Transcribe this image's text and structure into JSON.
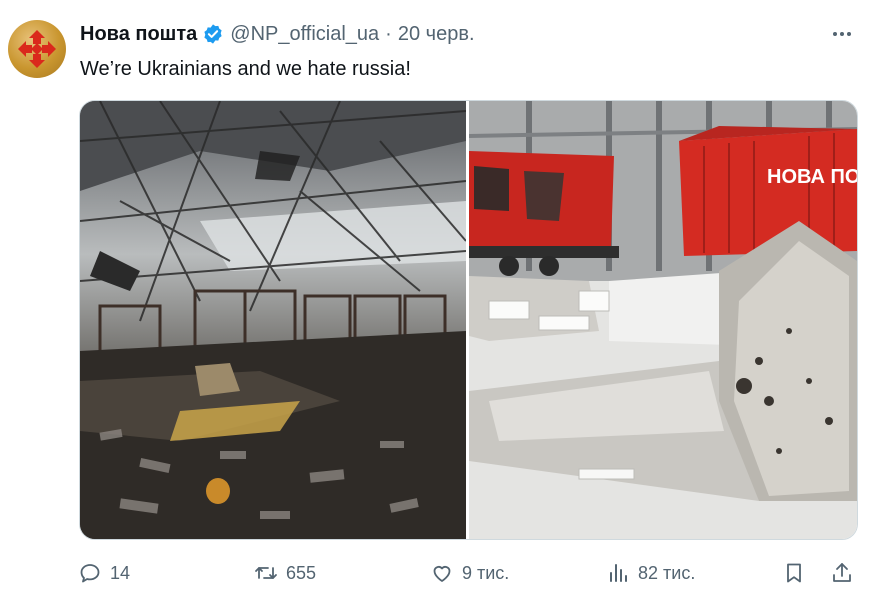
{
  "account": {
    "name": "Нова пошта",
    "handle": "@NP_official_ua",
    "separator": "·",
    "date": "20 черв."
  },
  "post": {
    "text": "We’re Ukrainians and we hate russia!"
  },
  "images": [
    {
      "label": "Destroyed warehouse interior"
    },
    {
      "label": "Damaged red trailers and debris",
      "trailer_text": "НОВА ПОШ"
    }
  ],
  "actions": {
    "replies": "14",
    "reposts": "655",
    "likes": "9 тис.",
    "views": "82 тис."
  },
  "colors": {
    "verified": "#1d9bf0",
    "icon_gray": "#536471",
    "brand_red": "#da291c"
  },
  "icons": [
    "more-icon",
    "verified-icon",
    "reply-icon",
    "retweet-icon",
    "like-icon",
    "views-icon",
    "bookmark-icon",
    "share-icon"
  ]
}
